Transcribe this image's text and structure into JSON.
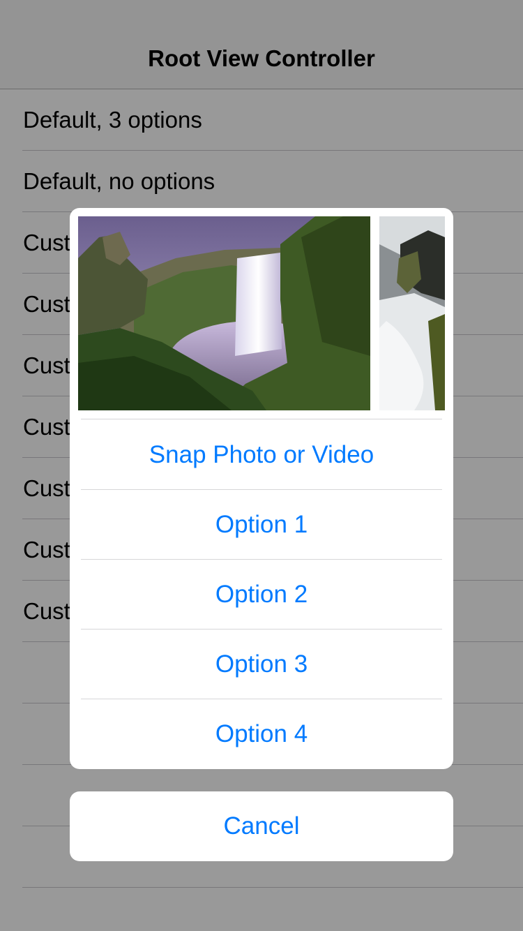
{
  "navbar": {
    "title": "Root View Controller"
  },
  "table": {
    "rows": [
      "Default, 3 options",
      "Default, no options",
      "Cust",
      "Cust",
      "Cust",
      "Cust",
      "Cust",
      "Cust",
      "Cust",
      "",
      "",
      "",
      ""
    ]
  },
  "action_sheet": {
    "photos": [
      "waterfall-photo",
      "rapids-photo"
    ],
    "buttons": [
      "Snap Photo or Video",
      "Option 1",
      "Option 2",
      "Option 3",
      "Option 4"
    ],
    "cancel": "Cancel"
  },
  "colors": {
    "accent": "#007aff",
    "overlay": "rgba(0,0,0,0.4)"
  }
}
